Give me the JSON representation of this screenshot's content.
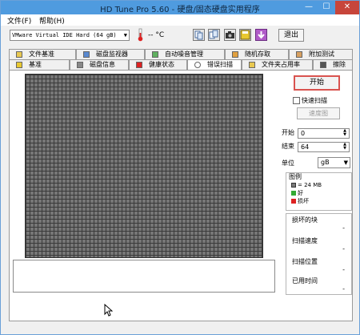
{
  "window": {
    "title": "HD Tune Pro 5.60 - 硬盘/固态硬盘实用程序",
    "minimize": "—",
    "maximize": "☐",
    "close": "✕"
  },
  "menu": {
    "file": "文件(F)",
    "help": "帮助(H)"
  },
  "toolbar": {
    "drive": "VMware Virtual IDE Hard (64 gB)",
    "temperature": "-- °C",
    "exit_label": "退出",
    "icons": [
      "copy-info-icon",
      "copy-screen-icon",
      "screenshot-camera-icon",
      "save-disk-icon",
      "download-icon"
    ]
  },
  "tabs_top": [
    "文件基准",
    "磁盘监视器",
    "自动噪音管理",
    "随机存取",
    "附加测试"
  ],
  "tabs_bottom": [
    "基准",
    "磁盘信息",
    "健康状态",
    "错误扫描",
    "文件夹占用率",
    "擦除"
  ],
  "active_tab": "错误扫描",
  "scan": {
    "start_label": "开始",
    "quick_scan_label": "快速扫描",
    "quick_scan_checked": false,
    "speed_map_label": "速度图",
    "start_field_label": "开始",
    "start_value": "0",
    "end_field_label": "结束",
    "end_value": "64",
    "unit_label": "单位",
    "unit_value": "gB"
  },
  "legend": {
    "title": "图例",
    "block_size": "= 24 MB",
    "good": "好",
    "bad": "损坏",
    "colors": {
      "block": "#7a7a7a",
      "good": "#33aa33",
      "bad": "#dd2222"
    }
  },
  "stats": {
    "damaged_blocks_label": "损坏的块",
    "damaged_blocks_value": "-",
    "scan_speed_label": "扫描速度",
    "scan_speed_value": "-",
    "scan_position_label": "扫描位置",
    "scan_position_value": "-",
    "elapsed_label": "已用时间",
    "elapsed_value": "-"
  }
}
